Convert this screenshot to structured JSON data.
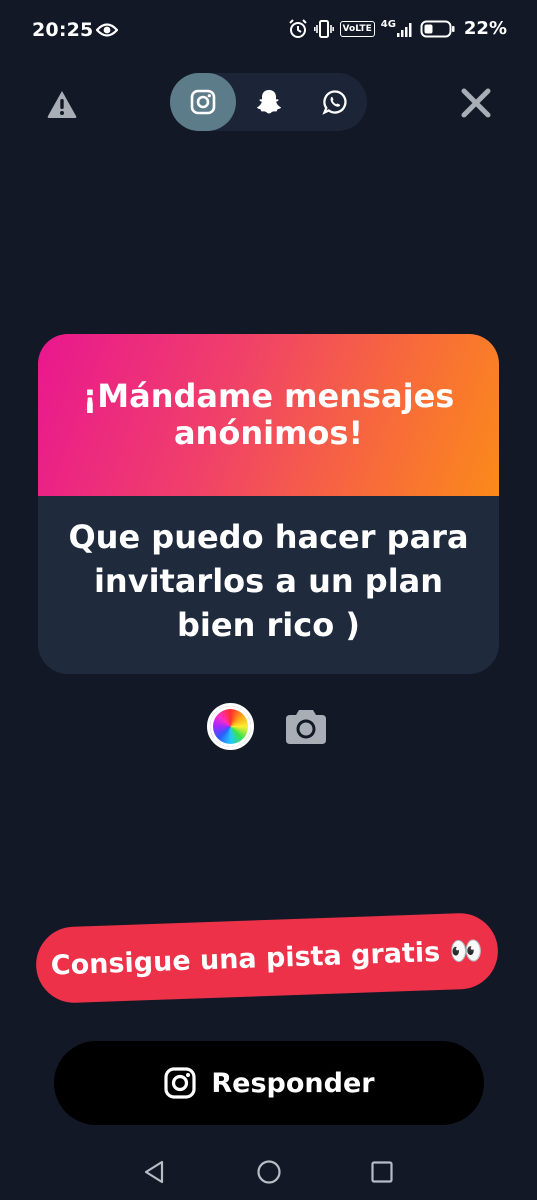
{
  "status_bar": {
    "time": "20:25",
    "network": "4G",
    "volte": "VoLTE",
    "battery_percent": "22%"
  },
  "share_bar": {
    "tabs": [
      {
        "icon": "instagram-icon",
        "active": true
      },
      {
        "icon": "snapchat-icon",
        "active": false
      },
      {
        "icon": "whatsapp-icon",
        "active": false
      }
    ]
  },
  "card": {
    "title": "¡Mándame mensajes anónimos!",
    "message": "Que puedo hacer para invitarlos a un plan bien rico )",
    "gradient": [
      "#e9178f",
      "#fb8a1a"
    ],
    "body_color": "#1f2b3d"
  },
  "hint_button": {
    "label": "Consigue una pista gratis 👀",
    "color": "#ec3148"
  },
  "reply_button": {
    "label": "Responder",
    "icon": "instagram-icon"
  },
  "colors": {
    "background": "#121826",
    "share_active": "#5c7c8a"
  }
}
